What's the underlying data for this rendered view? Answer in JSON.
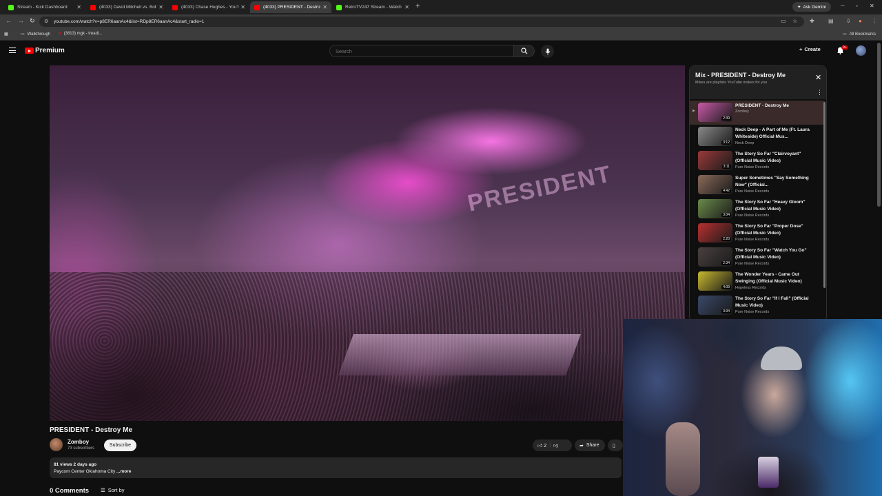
{
  "browser": {
    "tabs": [
      {
        "title": "Stream - Kick Dashboard",
        "favicon_color": "#53fc18",
        "active": false
      },
      {
        "title": "(4033) David Mitchell vs. Bob M",
        "favicon_color": "#ff0000",
        "active": false
      },
      {
        "title": "(4033) Chase Hughes - YouTube",
        "favicon_color": "#ff0000",
        "active": false
      },
      {
        "title": "(4033) PRESIDENT - Destroy Me",
        "favicon_color": "#ff0000",
        "active": true
      },
      {
        "title": "RetroTV247 Stream - Watch Li",
        "favicon_color": "#53fc18",
        "active": false
      }
    ],
    "ask_gemini": "Ask Gemini",
    "url": "youtube.com/watch?v=p8ER6aanAc4&list=RDp8ER6aanAc4&start_radio=1",
    "bookmarks": [
      {
        "label": "Walkthrough"
      },
      {
        "label": "(3813) mgk - treadi..."
      }
    ],
    "all_bookmarks": "All Bookmarks"
  },
  "youtube": {
    "logo_text": "Premium",
    "search_placeholder": "Search",
    "create_label": "Create",
    "notification_count": "9+",
    "brand_color": "#ff0000"
  },
  "video": {
    "title": "PRESIDENT - Destroy Me",
    "stage_text": "PRESIDENT",
    "channel": "Zomboy",
    "subscribers": "73 subscribers",
    "subscribe_label": "Subscribe",
    "likes": "2",
    "share_label": "Share",
    "views_date": "81 views  2 days ago",
    "description": "Paycom Center Oklahoma City",
    "more_label": "...more",
    "comments_label": "0 Comments",
    "sort_label": "Sort by"
  },
  "playlist": {
    "title": "Mix - PRESIDENT - Destroy Me",
    "subtitle": "Mixes are playlists YouTube makes for you",
    "items": [
      {
        "title": "PRESIDENT - Destroy Me",
        "channel": "Zomboy",
        "duration": "2:39",
        "thumb": "#c85aa8",
        "active": true
      },
      {
        "title": "Neck Deep - A Part of Me (Ft. Laura Whiteside) Official Mus...",
        "channel": "Neck Deep",
        "duration": "3:12",
        "thumb": "#8a8a8a",
        "active": false
      },
      {
        "title": "The Story So Far \"Clairvoyant\" (Official Music Video)",
        "channel": "Pure Noise Records",
        "duration": "3:11",
        "thumb": "#9a3a3a",
        "active": false
      },
      {
        "title": "Super Sometimes \"Say Something Now\" (Official...",
        "channel": "Pure Noise Records",
        "duration": "4:42",
        "thumb": "#8a6a5a",
        "active": false
      },
      {
        "title": "The Story So Far \"Heavy Gloom\" (Official Music Video)",
        "channel": "Pure Noise Records",
        "duration": "3:04",
        "thumb": "#6a8a4a",
        "active": false
      },
      {
        "title": "The Story So Far \"Proper Dose\" (Official Music Video)",
        "channel": "Pure Noise Records",
        "duration": "2:20",
        "thumb": "#b83030",
        "active": false
      },
      {
        "title": "The Story So Far \"Watch You Go\" (Official Music Video)",
        "channel": "Pure Noise Records",
        "duration": "2:34",
        "thumb": "#4a4040",
        "active": false
      },
      {
        "title": "The Wonder Years - Came Out Swinging (Official Music Video)",
        "channel": "Hopeless Records",
        "duration": "4:09",
        "thumb": "#c8b830",
        "active": false
      },
      {
        "title": "The Story So Far \"If I Fall\" (Official Music Video)",
        "channel": "Pure Noise Records",
        "duration": "3:34",
        "thumb": "#3a4a6a",
        "active": false
      }
    ]
  }
}
